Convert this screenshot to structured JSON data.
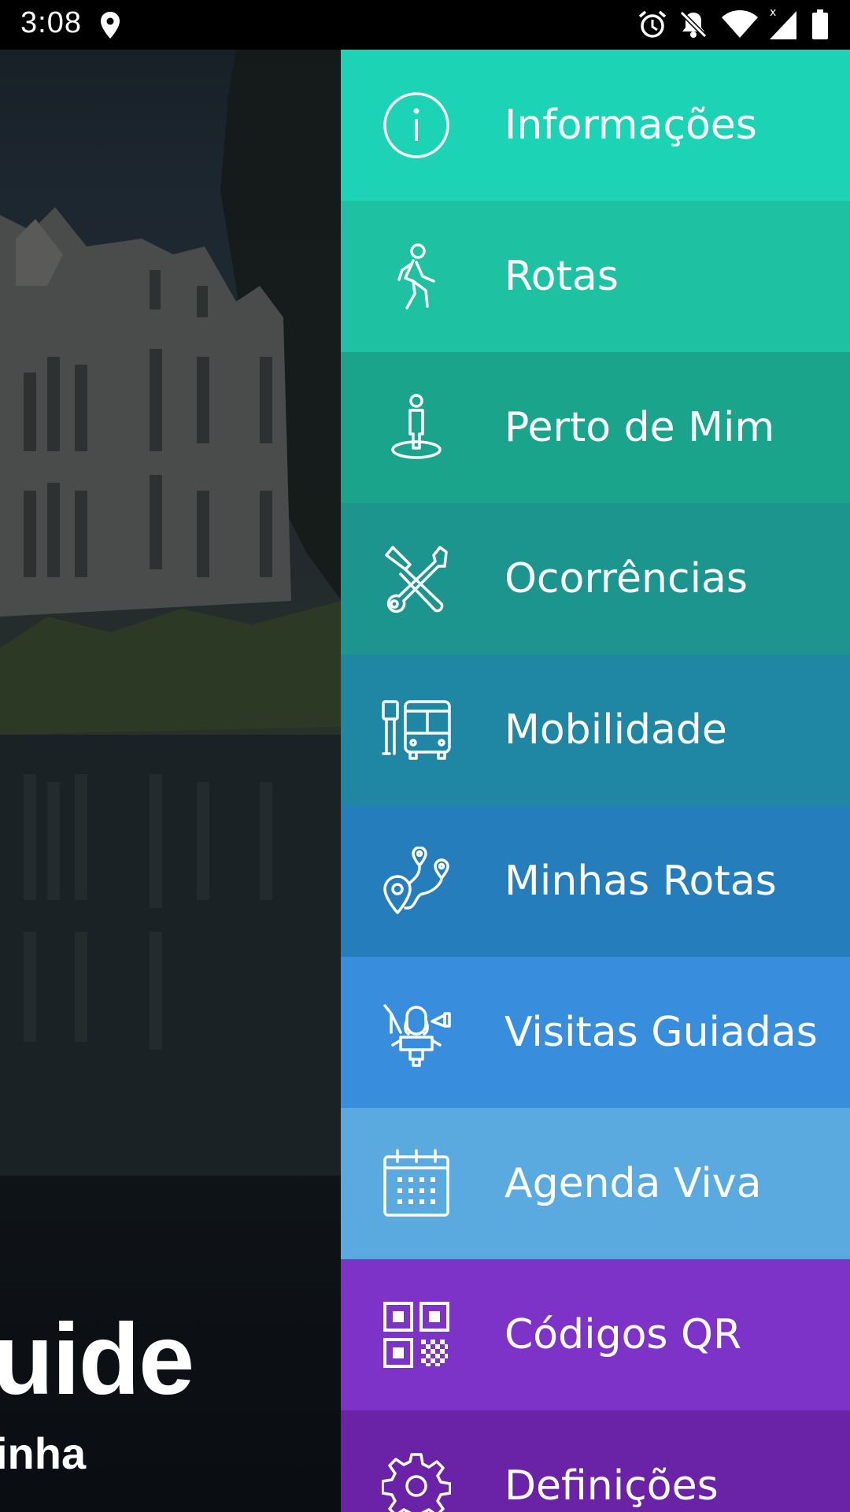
{
  "status_bar": {
    "time": "3:08",
    "icons": [
      "location-icon",
      "alarm-icon",
      "notifications-off-icon",
      "wifi-icon",
      "signal-icon",
      "battery-icon"
    ]
  },
  "background": {
    "title": "uide",
    "subtitle": "inha"
  },
  "menu": {
    "items": [
      {
        "label": "Informações",
        "icon": "info-icon",
        "color": "#1dd3b6"
      },
      {
        "label": "Rotas",
        "icon": "walking-person-icon",
        "color": "#1ec1a1"
      },
      {
        "label": "Perto de Mim",
        "icon": "person-location-icon",
        "color": "#1ba48c"
      },
      {
        "label": "Ocorrências",
        "icon": "tools-icon",
        "color": "#1c958f"
      },
      {
        "label": "Mobilidade",
        "icon": "bus-stop-icon",
        "color": "#1f87a3"
      },
      {
        "label": "Minhas Rotas",
        "icon": "route-pins-icon",
        "color": "#267dbb"
      },
      {
        "label": "Visitas Guiadas",
        "icon": "tour-guide-icon",
        "color": "#388edc"
      },
      {
        "label": "Agenda Viva",
        "icon": "calendar-icon",
        "color": "#5aaae0"
      },
      {
        "label": "Códigos QR",
        "icon": "qr-code-icon",
        "color": "#7e33c8"
      },
      {
        "label": "Definições",
        "icon": "gear-icon",
        "color": "#6a22a6"
      }
    ]
  }
}
